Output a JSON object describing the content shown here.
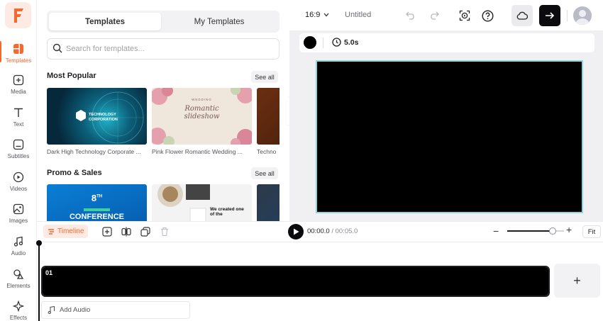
{
  "sidebar": {
    "items": [
      {
        "label": "Templates",
        "icon": "templates-icon"
      },
      {
        "label": "Media",
        "icon": "media-icon"
      },
      {
        "label": "Text",
        "icon": "text-icon"
      },
      {
        "label": "Subtitles",
        "icon": "subtitles-icon"
      },
      {
        "label": "Videos",
        "icon": "videos-icon"
      },
      {
        "label": "Images",
        "icon": "images-icon"
      },
      {
        "label": "Audio",
        "icon": "audio-icon"
      },
      {
        "label": "Elements",
        "icon": "elements-icon"
      },
      {
        "label": "Effects",
        "icon": "effects-icon"
      }
    ]
  },
  "templates_panel": {
    "tabs": [
      {
        "label": "Templates",
        "active": true
      },
      {
        "label": "My Templates",
        "active": false
      }
    ],
    "search": {
      "placeholder": "Search for templates..."
    },
    "sections": [
      {
        "title": "Most Popular",
        "see_all": "See all",
        "items": [
          {
            "caption": "Dark High Technology Corporate ...",
            "overlay": "TECHNOLOGY CORPORATION"
          },
          {
            "caption": "Pink Flower Romantic Wedding ...",
            "overlay_top": "WEDDING",
            "overlay_main": "Romantic slideshow"
          },
          {
            "caption": "Techno"
          }
        ]
      },
      {
        "title": "Promo & Sales",
        "see_all": "See all",
        "items": [
          {
            "overlay_top": "8",
            "overlay_sup": "TH",
            "overlay_main": "CONFERENCE"
          },
          {
            "overlay_main": "We created one of the"
          },
          {
            "overlay_main": ""
          }
        ]
      }
    ]
  },
  "topbar": {
    "aspect_ratio": "16:9",
    "project_title": "Untitled"
  },
  "property_bar": {
    "background_color": "#000000",
    "duration": "5.0s"
  },
  "timeline": {
    "label": "Timeline",
    "current_time": "00:00.0",
    "separator": " / ",
    "total_time": "00:05.0",
    "zoom_fraction": 0.8,
    "fit_label": "Fit",
    "clip_number": "01",
    "add_audio_label": "Add Audio",
    "add_clip_label": "+"
  },
  "colors": {
    "accent": "#f26a2e",
    "stage_outline": "#8fd3dc"
  }
}
